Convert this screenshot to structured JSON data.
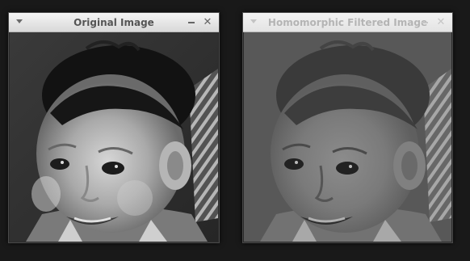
{
  "windows": [
    {
      "title": "Original Image",
      "state": "active",
      "menu_icon": "chevron-down-icon",
      "minimize_icon": "minimize-icon",
      "close_icon": "close-icon",
      "close_glyph": "✕"
    },
    {
      "title": "Homomorphic Filtered Image",
      "state": "inactive",
      "menu_icon": "chevron-down-icon",
      "minimize_icon": "minimize-icon",
      "close_icon": "close-icon",
      "close_glyph": "✕"
    }
  ],
  "colors": {
    "desktop": "#191919",
    "titlebar_active_text": "#555555",
    "titlebar_inactive_text": "#b4b4b4"
  }
}
